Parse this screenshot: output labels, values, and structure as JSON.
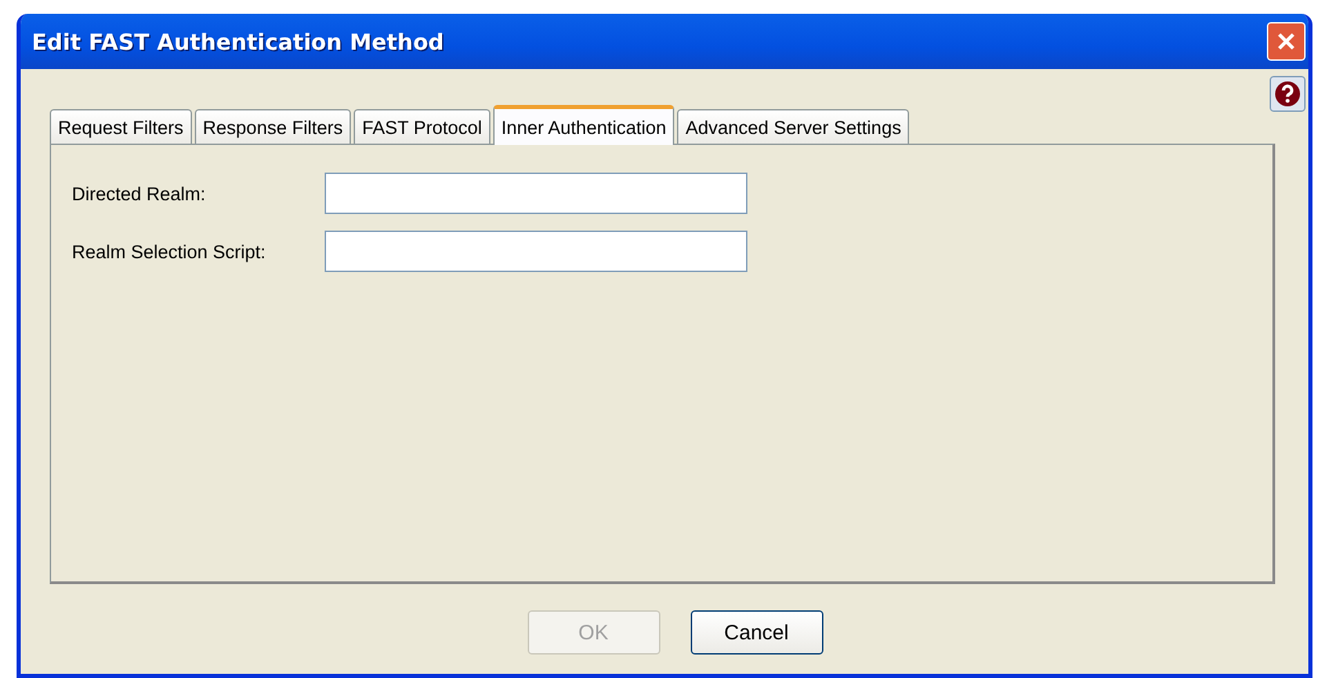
{
  "window": {
    "title": "Edit FAST Authentication Method"
  },
  "tabs": [
    {
      "label": "Request Filters",
      "selected": false
    },
    {
      "label": "Response Filters",
      "selected": false
    },
    {
      "label": "FAST Protocol",
      "selected": false
    },
    {
      "label": "Inner Authentication",
      "selected": true
    },
    {
      "label": "Advanced Server Settings",
      "selected": false
    }
  ],
  "fields": [
    {
      "label": "Directed Realm:"
    },
    {
      "label": "Realm Selection Script:"
    }
  ],
  "buttons": [
    {
      "label": "OK",
      "disabled": true
    },
    {
      "label": "Cancel",
      "disabled": false
    }
  ]
}
